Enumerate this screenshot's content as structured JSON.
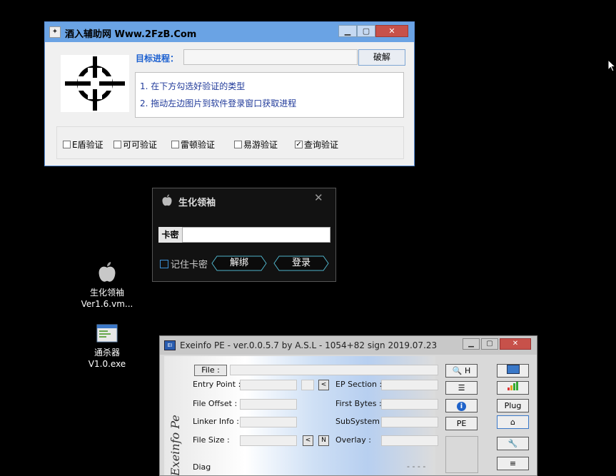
{
  "win1": {
    "title": "酒入辅助网 Www.2FzB.Com",
    "label_target": "目标进程：",
    "crack_button": "破解",
    "info_lines": [
      "1. 在下方勾选好验证的类型",
      "2. 拖动左边图片到软件登录窗口获取进程"
    ],
    "options": [
      {
        "label": "E盾验证",
        "checked": false
      },
      {
        "label": "可可验证",
        "checked": false
      },
      {
        "label": "雷顿验证",
        "checked": false
      },
      {
        "label": "易游验证",
        "checked": false
      },
      {
        "label": "查询验证",
        "checked": true
      }
    ]
  },
  "win2": {
    "title": "生化领袖",
    "key_label": "卡密",
    "remember_label": "记住卡密",
    "unbind_button": "解绑",
    "login_button": "登录"
  },
  "desktop": {
    "icons": [
      {
        "name1": "生化领袖",
        "name2": "Ver1.6.vm..."
      },
      {
        "name1": "通杀器",
        "name2": "V1.0.exe"
      }
    ]
  },
  "win3": {
    "title": "Exeinfo PE - ver.0.0.5.7  by A.S.L -  1054+82 sign  2019.07.23",
    "file_button": "File :",
    "entry_point": "Entry Point :",
    "ep_section": "EP Section :",
    "file_offset": "File Offset :",
    "first_bytes": "First Bytes :",
    "linker_info": "Linker Info :",
    "subsystem": "SubSystem :",
    "file_size": "File Size :",
    "overlay": "Overlay :",
    "diag": "Diag",
    "dashes": "- - - -",
    "side_text": "Exeinfo Pe",
    "btn_h": "H",
    "btn_plug": "Plug",
    "btn_pe": "PE",
    "btn_lt": "<",
    "btn_n": "N"
  }
}
